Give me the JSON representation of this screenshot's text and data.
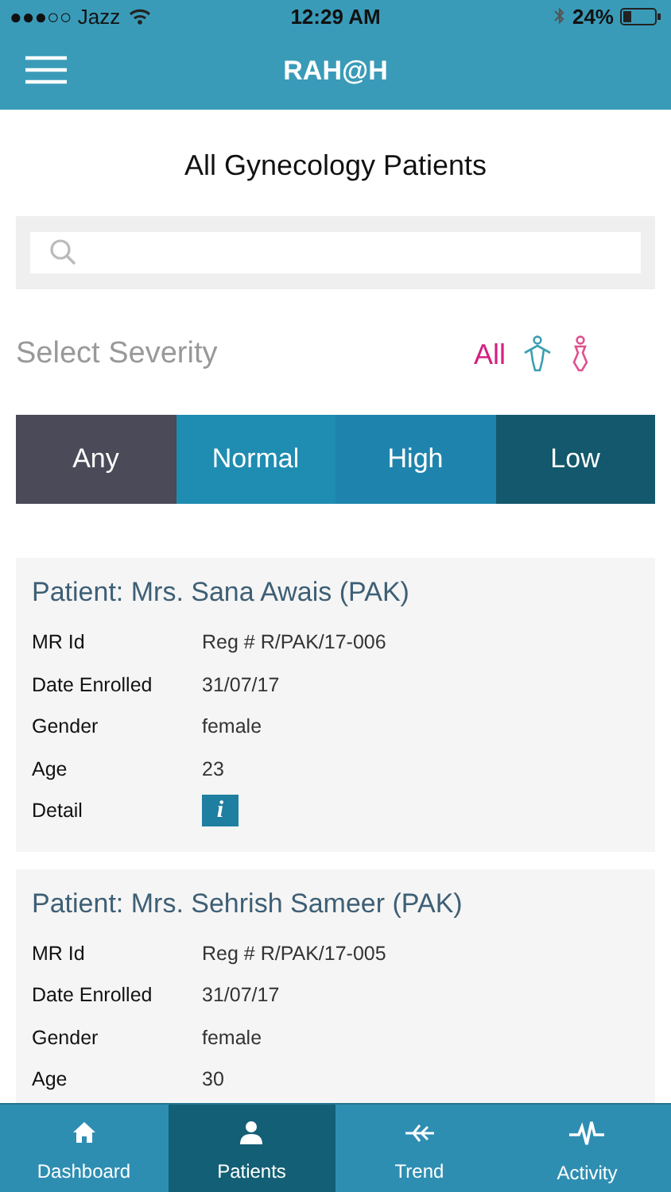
{
  "status_bar": {
    "carrier": "●●●○○ Jazz",
    "time": "12:29 AM",
    "battery": "24%"
  },
  "header": {
    "title": "RAH@H"
  },
  "page_title": "All Gynecology Patients",
  "severity": {
    "label": "Select Severity",
    "gender_filter": [
      {
        "kind": "text",
        "label": "All",
        "selected": true
      },
      {
        "kind": "male",
        "selected": false
      },
      {
        "kind": "female",
        "selected": false
      }
    ],
    "options": [
      {
        "label": "Any",
        "color": "#4a4a58"
      },
      {
        "label": "Normal",
        "color": "#1f8cb2"
      },
      {
        "label": "High",
        "color": "#1f84ad"
      },
      {
        "label": "Low",
        "color": "#13586c"
      }
    ]
  },
  "patients": [
    {
      "title": "Patient: Mrs. Sana Awais (PAK)",
      "fields": [
        {
          "kind": "text",
          "label": "MR Id",
          "value": "Reg # R/PAK/17-006"
        },
        {
          "kind": "text",
          "label": "Date Enrolled",
          "value": "31/07/17"
        },
        {
          "kind": "text",
          "label": "Gender",
          "value": "female"
        },
        {
          "kind": "text",
          "label": "Age",
          "value": "23"
        },
        {
          "kind": "info",
          "label": "Detail",
          "value": "i"
        }
      ]
    },
    {
      "title": "Patient: Mrs. Sehrish Sameer (PAK)",
      "fields": [
        {
          "kind": "text",
          "label": "MR Id",
          "value": "Reg # R/PAK/17-005"
        },
        {
          "kind": "text",
          "label": "Date Enrolled",
          "value": "31/07/17"
        },
        {
          "kind": "text",
          "label": "Gender",
          "value": "female"
        },
        {
          "kind": "text",
          "label": "Age",
          "value": "30"
        }
      ]
    }
  ],
  "tab_bar": [
    {
      "label": "Dashboard",
      "kind": "home",
      "selected": false
    },
    {
      "label": "Patients",
      "kind": "person",
      "selected": true
    },
    {
      "label": "Trend",
      "kind": "trend",
      "selected": false
    },
    {
      "label": "Activity",
      "kind": "pulse",
      "selected": false
    }
  ]
}
